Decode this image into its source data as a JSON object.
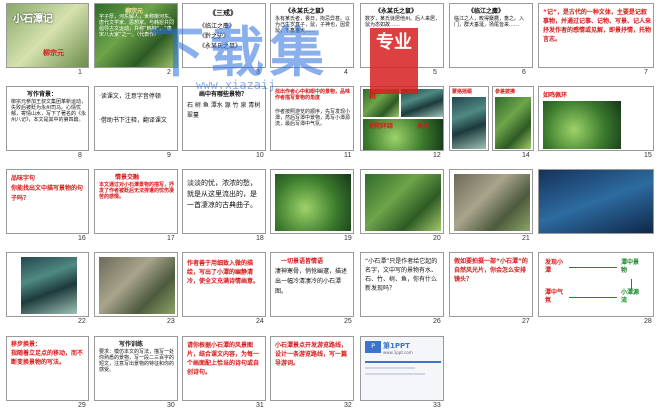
{
  "slides": [
    {
      "n": "1",
      "title": "小石潭记",
      "author": "柳宗元"
    },
    {
      "n": "2",
      "title": "柳宗元",
      "text": "字子厚，河东解人，世称柳河东。唐代文学家、思想家。与韩愈共同倡导古文运动，并称“韩柳”，“唐宋八大家”之一。（代表作）"
    },
    {
      "n": "3",
      "title": "《三戒》",
      "items": [
        "《临江之麋》",
        "《黔之驴》",
        "《永某氏之鼠》"
      ]
    },
    {
      "n": "4",
      "title": "《永某氏之鼠》",
      "text": "永有某氏者，畏日，拘忌异甚。以为己生岁直子，鼠，子神也，因爱鼠，不畜猫犬……"
    },
    {
      "n": "5",
      "title": "《永某氏之鼠》",
      "text": "数岁，某氏徙居他州。后人来居，鼠为态如故……"
    },
    {
      "n": "6",
      "title": "《临江之麋》",
      "text": "临江之人，畋得麋麑，畜之。入门，群犬垂涎，扬尾皆来……"
    },
    {
      "n": "7",
      "title": "“记”，是古代的一种文体，主要是记叙事物，并通过记事、记物、写景、记人来抒发作者的感情或见解，即景抒情，托物言志。"
    },
    {
      "n": "8",
      "title": "写作背景：",
      "text": "柳宗元参加王叔文集团革新运动，失败后被贬为永州司马。心情忧郁，寄情山水，写下了著名的《永州八记》，本文是其中的第四篇。"
    },
    {
      "n": "9",
      "title": "·读课文，注意字音停顿",
      "text": "·借助书下注释，翻译课文"
    },
    {
      "n": "10",
      "title": "画中有哪些景物？",
      "text": "石 树 鱼 潭水 源 竹 泉 青树 翠蔓"
    },
    {
      "n": "11",
      "title": "找出作者心中和眼中的景物，品味作者描写景物的角度",
      "text": "作者按照游览的顺序，先写发现小潭，然后写潭中景物，再写小潭源流，最后写潭中气氛。"
    },
    {
      "n": "12",
      "label": "树",
      "label2": "树阴环绕",
      "label3": "泉水"
    },
    {
      "n": "13",
      "title": "蒙络摇缀"
    },
    {
      "n": "14",
      "title": "参差披拂"
    },
    {
      "n": "15",
      "title": "如鸣佩环"
    },
    {
      "n": "16",
      "title": "品味字句",
      "text": "你能找出文中描写景物的句子吗？"
    },
    {
      "n": "17",
      "title": "情景交融",
      "text": "本文通过对小石潭景物的描写，抒发了作者被贬后无法排遣的忧伤凄苦的感情。"
    },
    {
      "n": "18",
      "title": "潭 源",
      "text": "淡淡的忧，浓浓的愁，就是从这里流出的，是一首凄凉的古典曲子。"
    },
    {
      "n": "19"
    },
    {
      "n": "20"
    },
    {
      "n": "21"
    },
    {
      "n": "22"
    },
    {
      "n": "23"
    },
    {
      "n": "24",
      "text": "作者善于用细致入微的描绘，写出了小潭的幽静清冷，使全文充满诗情画意。"
    },
    {
      "n": "25",
      "title": "一切景语皆情语",
      "text": "凄神寒骨，悄怆幽邃，描述出一幅冷清凄冷的小石潭图。"
    },
    {
      "n": "26",
      "text": "“小石潭”只是作者给它起的名字，文中写的景物有水、石、竹、树、鱼，你有什么新发现吗？"
    },
    {
      "n": "27",
      "title": "假如要拍摄一部“小石潭”的自然风光片，你会怎么安排镜头？"
    },
    {
      "n": "28",
      "items": [
        "发现小潭",
        "潭中景物",
        "小潭源流",
        "潭中气氛"
      ]
    },
    {
      "n": "29",
      "title": "移步换景：",
      "text": "指随着立足点的移动，而不断变换景物的写法。"
    },
    {
      "n": "30",
      "title": "写作训练",
      "text": "要求：模仿本文的写法，描写一处你熟悉的景物，写一段二三百字的短文，注意写出景物的特征和你的感受。"
    },
    {
      "n": "31",
      "title": "请你根据小石潭的风景图片，结合课文内容，为每一个画面配上恰当的诗句或自创诗句。"
    },
    {
      "n": "32",
      "title": "小石潭景点开发游览路线，设计一条游览路线，写一篇导游词。"
    },
    {
      "n": "33",
      "title": "第1PPT",
      "sub": "www.1ppt.com"
    }
  ],
  "watermark": {
    "text": "下载集",
    "url": "www.xiazaij",
    "badge": "专业"
  }
}
